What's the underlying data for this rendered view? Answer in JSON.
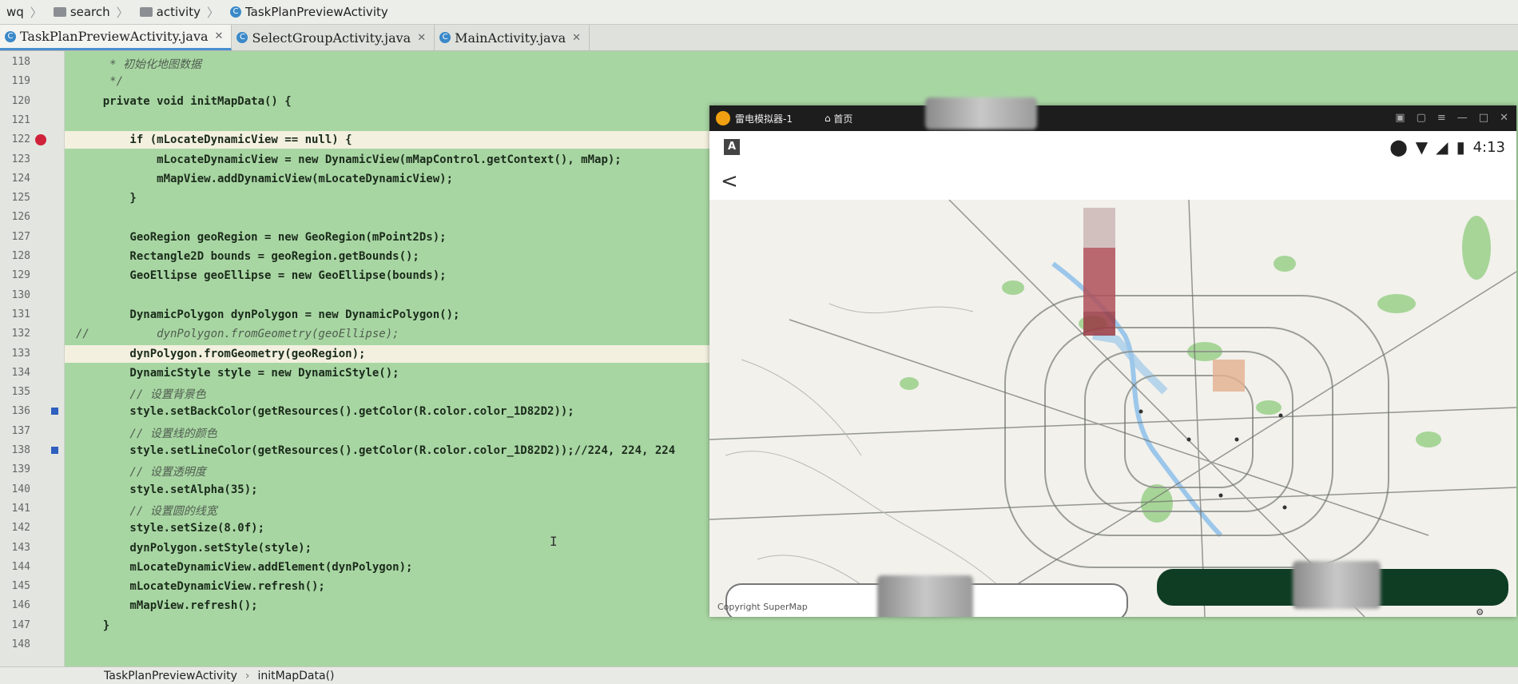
{
  "breadcrumb": [
    "wq",
    "search",
    "activity",
    "TaskPlanPreviewActivity"
  ],
  "tabs": [
    {
      "label": "TaskPlanPreviewActivity.java",
      "active": true
    },
    {
      "label": "SelectGroupActivity.java",
      "active": false
    },
    {
      "label": "MainActivity.java",
      "active": false
    }
  ],
  "code_lines": [
    {
      "n": "118",
      "text": "     * 初始化地图数据",
      "kind": "comment"
    },
    {
      "n": "119",
      "text": "     */",
      "kind": "comment"
    },
    {
      "n": "120",
      "text": "    private void initMapData() {",
      "kind": "code"
    },
    {
      "n": "121",
      "text": "",
      "kind": "code"
    },
    {
      "n": "122",
      "text": "        if (mLocateDynamicView == null) {",
      "kind": "code"
    },
    {
      "n": "123",
      "text": "            mLocateDynamicView = new DynamicView(mMapControl.getContext(), mMap);",
      "kind": "code"
    },
    {
      "n": "124",
      "text": "            mMapView.addDynamicView(mLocateDynamicView);",
      "kind": "code"
    },
    {
      "n": "125",
      "text": "        }",
      "kind": "code"
    },
    {
      "n": "126",
      "text": "",
      "kind": "code"
    },
    {
      "n": "127",
      "text": "        GeoRegion geoRegion = new GeoRegion(mPoint2Ds);",
      "kind": "code"
    },
    {
      "n": "128",
      "text": "        Rectangle2D bounds = geoRegion.getBounds();",
      "kind": "code"
    },
    {
      "n": "129",
      "text": "        GeoEllipse geoEllipse = new GeoEllipse(bounds);",
      "kind": "code"
    },
    {
      "n": "130",
      "text": "",
      "kind": "code"
    },
    {
      "n": "131",
      "text": "        DynamicPolygon dynPolygon = new DynamicPolygon();",
      "kind": "code"
    },
    {
      "n": "132",
      "text": "//          dynPolygon.fromGeometry(geoEllipse);",
      "kind": "comment"
    },
    {
      "n": "133",
      "text": "        dynPolygon.fromGeometry(geoRegion);",
      "kind": "code"
    },
    {
      "n": "134",
      "text": "        DynamicStyle style = new DynamicStyle();",
      "kind": "code"
    },
    {
      "n": "135",
      "text": "        // 设置背景色",
      "kind": "comment"
    },
    {
      "n": "136",
      "text": "        style.setBackColor(getResources().getColor(R.color.color_1D82D2));",
      "kind": "code"
    },
    {
      "n": "137",
      "text": "        // 设置线的颜色",
      "kind": "comment"
    },
    {
      "n": "138",
      "text": "        style.setLineColor(getResources().getColor(R.color.color_1D82D2));//224, 224, 224",
      "kind": "code"
    },
    {
      "n": "139",
      "text": "        // 设置透明度",
      "kind": "comment"
    },
    {
      "n": "140",
      "text": "        style.setAlpha(35);",
      "kind": "code"
    },
    {
      "n": "141",
      "text": "        // 设置圆的线宽",
      "kind": "comment"
    },
    {
      "n": "142",
      "text": "        style.setSize(8.0f);",
      "kind": "code"
    },
    {
      "n": "143",
      "text": "        dynPolygon.setStyle(style);",
      "kind": "code"
    },
    {
      "n": "144",
      "text": "        mLocateDynamicView.addElement(dynPolygon);",
      "kind": "code"
    },
    {
      "n": "145",
      "text": "        mLocateDynamicView.refresh();",
      "kind": "code"
    },
    {
      "n": "146",
      "text": "        mMapView.refresh();",
      "kind": "code"
    },
    {
      "n": "147",
      "text": "    }",
      "kind": "code"
    },
    {
      "n": "148",
      "text": "",
      "kind": "code"
    }
  ],
  "status_bar": {
    "class_name": "TaskPlanPreviewActivity",
    "method_name": "initMapData()"
  },
  "emulator": {
    "title": "雷电模拟器-1",
    "home_label": "首页",
    "phone_time": "4:13",
    "back_glyph": "<",
    "a_badge": "A",
    "copyright": "Copyright SuperMap"
  },
  "colors": {
    "code_bg": "#a8d6a3",
    "highlight_line": "#f3f0df",
    "breakpoint": "#d0213a",
    "button_dark_green": "#0f3d24"
  },
  "icons": [
    "c-class-icon",
    "folder-icon",
    "breakpoint-icon",
    "bookmark-icon",
    "location-icon",
    "wifi-icon",
    "signal-icon",
    "battery-icon",
    "gear-icon",
    "close-icon"
  ]
}
